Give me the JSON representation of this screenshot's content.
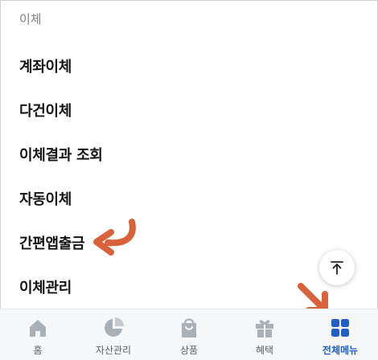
{
  "section": {
    "title": "이체"
  },
  "menu": [
    {
      "label": "계좌이체"
    },
    {
      "label": "다건이체"
    },
    {
      "label": "이체결과 조회"
    },
    {
      "label": "자동이체"
    },
    {
      "label": "간편앱출금"
    },
    {
      "label": "이체관리"
    }
  ],
  "scroll_top": {
    "icon": "arrow-up-to-top-icon"
  },
  "bottom_nav": [
    {
      "label": "홈",
      "icon": "home-icon",
      "active": false
    },
    {
      "label": "자산관리",
      "icon": "pie-chart-icon",
      "active": false
    },
    {
      "label": "상품",
      "icon": "shopping-bag-icon",
      "active": false
    },
    {
      "label": "혜택",
      "icon": "gift-icon",
      "active": false
    },
    {
      "label": "전체메뉴",
      "icon": "grid-menu-icon",
      "active": true
    }
  ],
  "colors": {
    "accent": "#1f5ec8",
    "icon_inactive": "#a9b0b8",
    "annotation_arrow": "#d9623b"
  }
}
